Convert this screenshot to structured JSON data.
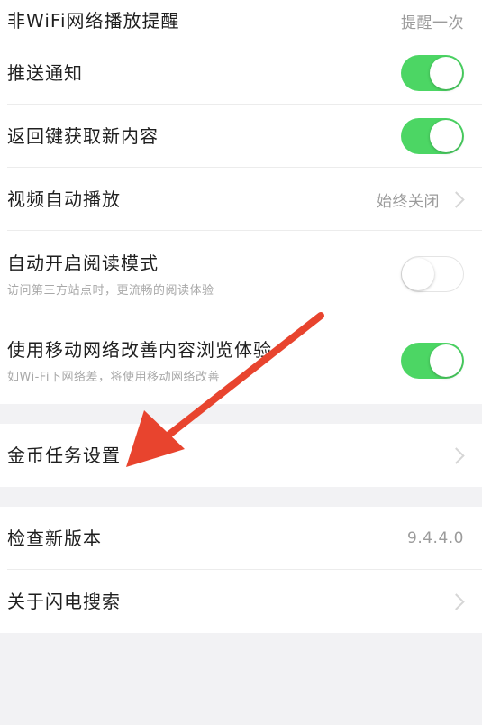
{
  "settings": {
    "non_wifi": {
      "label": "非WiFi网络播放提醒",
      "value": "提醒一次"
    },
    "push": {
      "label": "推送通知",
      "state": "on"
    },
    "back_refresh": {
      "label": "返回键获取新内容",
      "state": "on"
    },
    "video_autoplay": {
      "label": "视频自动播放",
      "value": "始终关闭"
    },
    "reader_mode": {
      "label": "自动开启阅读模式",
      "sub": "访问第三方站点时，更流畅的阅读体验",
      "state": "off"
    },
    "mobile_boost": {
      "label": "使用移动网络改善内容浏览体验",
      "sub": "如Wi-Fi下网络差，将使用移动网络改善",
      "state": "on"
    }
  },
  "coins": {
    "label": "金币任务设置"
  },
  "about": {
    "check_update": {
      "label": "检查新版本",
      "value": "9.4.4.0"
    },
    "about_app": {
      "label": "关于闪电搜索"
    }
  },
  "colors": {
    "toggle_on": "#4cd664",
    "annotation_arrow": "#e8442e"
  }
}
